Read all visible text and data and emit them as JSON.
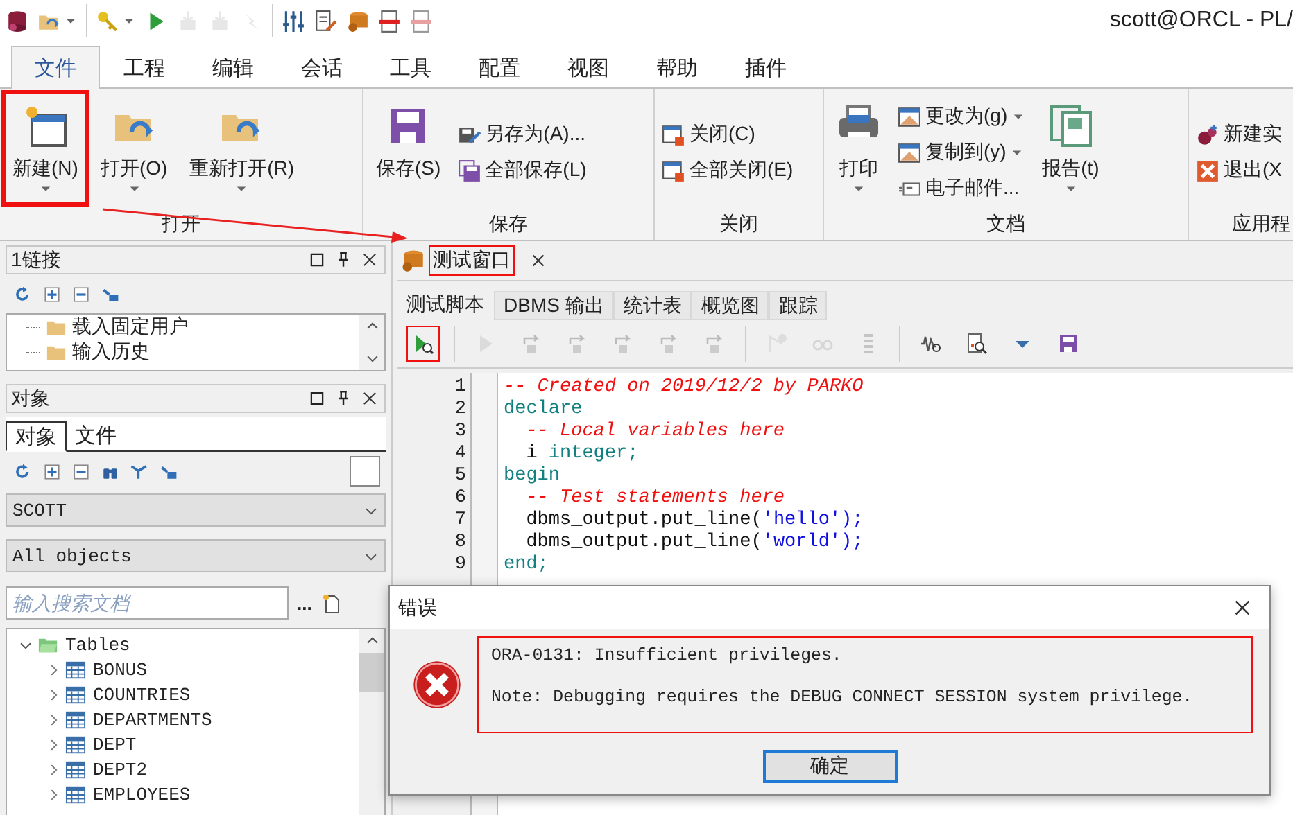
{
  "title_bar": {
    "title": "scott@ORCL - PL/"
  },
  "quick_access_toolbar": [
    {
      "disabled": false
    },
    {
      "disabled": false
    },
    {
      "disabled": false
    },
    {
      "disabled": false
    },
    {
      "disabled": true
    },
    {
      "disabled": true
    },
    {
      "disabled": true
    },
    {
      "disabled": false
    },
    {
      "disabled": false
    },
    {
      "disabled": false
    },
    {
      "disabled": false
    },
    {
      "disabled": false
    }
  ],
  "ribbon_tabs": [
    {
      "label": "文件",
      "selected": true
    },
    {
      "label": "工程",
      "selected": false
    },
    {
      "label": "编辑",
      "selected": false
    },
    {
      "label": "会话",
      "selected": false
    },
    {
      "label": "工具",
      "selected": false
    },
    {
      "label": "配置",
      "selected": false
    },
    {
      "label": "视图",
      "selected": false
    },
    {
      "label": "帮助",
      "selected": false
    },
    {
      "label": "插件",
      "selected": false
    }
  ],
  "ribbon_groups": [
    {
      "label": "打开",
      "items": [
        {
          "kind": "large",
          "label": "新建(N)",
          "menu": true,
          "marked": true
        },
        {
          "kind": "large",
          "label": "打开(O)",
          "menu": true,
          "marked": false
        },
        {
          "kind": "large",
          "label": "重新打开(R)",
          "menu": true,
          "marked": false
        }
      ]
    },
    {
      "label": "保存",
      "items": [
        {
          "kind": "large",
          "label": "保存(S)",
          "menu": false,
          "marked": false
        },
        {
          "kind": "small",
          "label": "另存为(A)...",
          "menu": false,
          "marked": false
        },
        {
          "kind": "small",
          "label": "全部保存(L)",
          "menu": false,
          "marked": false
        }
      ]
    },
    {
      "label": "关闭",
      "items": [
        {
          "kind": "small",
          "label": "关闭(C)",
          "menu": false,
          "marked": false
        },
        {
          "kind": "small",
          "label": "全部关闭(E)",
          "menu": false,
          "marked": false
        }
      ]
    },
    {
      "label": "文档",
      "items": [
        {
          "kind": "large",
          "label": "打印",
          "menu": true,
          "marked": false
        },
        {
          "kind": "small",
          "label": "更改为(g)",
          "menu": true,
          "marked": false
        },
        {
          "kind": "small",
          "label": "复制到(y)",
          "menu": true,
          "marked": false
        },
        {
          "kind": "small",
          "label": "电子邮件...",
          "menu": false,
          "marked": false
        },
        {
          "kind": "large",
          "label": "报告(t)",
          "menu": true,
          "marked": false
        }
      ]
    },
    {
      "label": "应用程",
      "items": [
        {
          "kind": "small",
          "label": "新建实",
          "menu": false,
          "marked": false
        },
        {
          "kind": "small",
          "label": "退出(X",
          "menu": false,
          "marked": false
        }
      ]
    }
  ],
  "connections_panel": {
    "title": "1链接",
    "items": [
      {
        "label": "载入固定用户"
      },
      {
        "label": "输入历史"
      }
    ]
  },
  "objects_panel": {
    "title": "对象",
    "tabs": [
      {
        "label": "对象",
        "selected": true
      },
      {
        "label": "文件",
        "selected": false
      }
    ],
    "owner": "SCOTT",
    "filter": "All objects",
    "search": {
      "placeholder": "输入搜索文档"
    },
    "more": "...",
    "tree": [
      {
        "label": "Tables",
        "expanded": true,
        "children": [
          {
            "label": "BONUS",
            "expanded": false,
            "selected": false
          },
          {
            "label": "COUNTRIES",
            "expanded": false,
            "selected": false
          },
          {
            "label": "DEPARTMENTS",
            "expanded": false,
            "selected": false
          },
          {
            "label": "DEPT",
            "expanded": false,
            "selected": false
          },
          {
            "label": "DEPT2",
            "expanded": false,
            "selected": false
          },
          {
            "label": "EMPLOYEES",
            "expanded": false,
            "selected": false
          }
        ]
      }
    ]
  },
  "document_tab": {
    "title": "测试窗口",
    "marked": true
  },
  "sub_tabs": [
    {
      "label": "测试脚本",
      "selected": true
    },
    {
      "label": "DBMS 输出",
      "selected": false
    },
    {
      "label": "统计表",
      "selected": false
    },
    {
      "label": "概览图",
      "selected": false
    },
    {
      "label": "跟踪",
      "selected": false
    }
  ],
  "toolbar": [
    {
      "disabled": false,
      "marked": true
    },
    {
      "disabled": true,
      "marked": false
    },
    {
      "disabled": true,
      "marked": false
    },
    {
      "disabled": true,
      "marked": false
    },
    {
      "disabled": true,
      "marked": false
    },
    {
      "disabled": true,
      "marked": false
    },
    {
      "disabled": true,
      "marked": false
    },
    {
      "disabled": true,
      "marked": false
    },
    {
      "disabled": true,
      "marked": false
    },
    {
      "disabled": true,
      "marked": false
    },
    {
      "disabled": false,
      "marked": false
    },
    {
      "disabled": false,
      "marked": false
    },
    {
      "disabled": false,
      "marked": false
    },
    {
      "disabled": false,
      "marked": false
    }
  ],
  "editor": {
    "lines": [
      {
        "number": "1",
        "tokens": [
          {
            "kind": "comment",
            "text": "-- Created on 2019/12/2 by PARKO"
          }
        ]
      },
      {
        "number": "2",
        "tokens": [
          {
            "kind": "keyword",
            "text": "declare"
          }
        ]
      },
      {
        "number": "3",
        "tokens": [
          {
            "kind": "comment",
            "text": "  -- Local variables here"
          }
        ]
      },
      {
        "number": "4",
        "tokens": [
          {
            "kind": "plain",
            "text": "  i "
          },
          {
            "kind": "keyword",
            "text": "integer;"
          }
        ]
      },
      {
        "number": "5",
        "tokens": [
          {
            "kind": "keyword",
            "text": "begin"
          }
        ]
      },
      {
        "number": "6",
        "tokens": [
          {
            "kind": "comment",
            "text": "  -- Test statements here"
          }
        ]
      },
      {
        "number": "7",
        "tokens": [
          {
            "kind": "plain",
            "text": "  dbms_output.put_line("
          },
          {
            "kind": "string",
            "text": "'hello');"
          }
        ]
      },
      {
        "number": "8",
        "tokens": [
          {
            "kind": "plain",
            "text": "  dbms_output.put_line("
          },
          {
            "kind": "string",
            "text": "'world');"
          }
        ]
      },
      {
        "number": "9",
        "tokens": [
          {
            "kind": "keyword",
            "text": "end;"
          }
        ]
      }
    ]
  },
  "error_dialog": {
    "title": "错误",
    "marked": true,
    "messages": [
      "ORA-0131: Insufficient privileges.",
      "Note: Debugging requires the DEBUG CONNECT SESSION system privilege."
    ],
    "button": "确定"
  }
}
